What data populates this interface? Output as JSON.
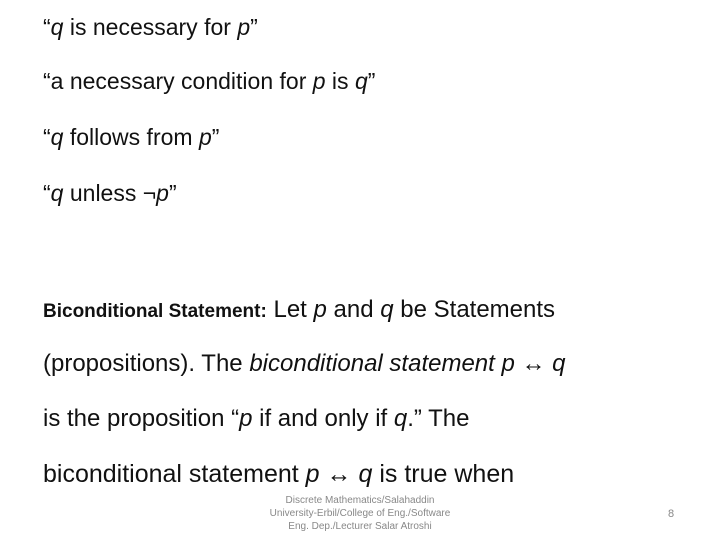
{
  "lines": [
    {
      "q1": "“",
      "v1": "q",
      "t1": " is necessary for ",
      "v2": "p",
      "q2": "”"
    },
    {
      "q1": "“a necessary condition for ",
      "v1": "p",
      "t1": " is ",
      "v2": "q",
      "q2": "”"
    },
    {
      "q1": "“",
      "v1": "q",
      "t1": " follows from ",
      "v2": "p",
      "q2": "”"
    },
    {
      "q1": "“",
      "v1": "q",
      "t1": " unless ¬",
      "v2": "p",
      "q2": "”"
    }
  ],
  "definition": {
    "term": "Biconditional Statement:",
    "l1_a": " Let ",
    "l1_p": "p",
    "l1_b": " and ",
    "l1_q": "q",
    "l1_c": " be Statements",
    "l2_a": "(propositions). The ",
    "l2_i": "biconditional statement p",
    "l2_arrow": " ↔ ",
    "l2_q": "q",
    "l3_a": "is the proposition “",
    "l3_p": "p",
    "l3_b": " if and only if ",
    "l3_q": "q",
    "l3_c": ".” The",
    "l4_a": "biconditional statement ",
    "l4_p": "p",
    "l4_arrow": " ↔ ",
    "l4_q": "q",
    "l4_b": " is true when"
  },
  "footer": {
    "line1": "Discrete Mathematics/Salahaddin",
    "line2": "University-Erbil/College of Eng./Software",
    "line3": "Eng. Dep./Lecturer Salar Atroshi",
    "page": "8"
  }
}
